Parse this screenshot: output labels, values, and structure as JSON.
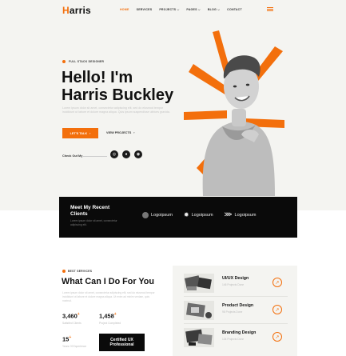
{
  "nav": {
    "logo_initial": "H",
    "logo_rest": "arris",
    "items": [
      {
        "label": "HOME",
        "active": true
      },
      {
        "label": "SERVICES",
        "active": false
      },
      {
        "label": "PROJECTS ⌵",
        "active": false
      },
      {
        "label": "PAGES ⌵",
        "active": false
      },
      {
        "label": "BLOG ⌵",
        "active": false
      },
      {
        "label": "CONTACT",
        "active": false
      }
    ],
    "menu_icon": "hamburger-icon"
  },
  "hero": {
    "badge": "FULL STACK DESIGNER",
    "title_line1": "Hello! I'm",
    "title_line2": "Harris Buckley",
    "description": "Lorem ipsum dolor sit amet, consectetur adipiscing elit, sed do eiusmod tempor incididunt ut labore et dolore magna aliqua. Quis ipsum suspendisse ultrices gravida.",
    "cta_primary": "LET'S TALK",
    "cta_secondary": "VIEW PROJECTS",
    "check_out": "Check Out My",
    "socials": [
      "dribbble-icon",
      "behance-icon",
      "instagram-icon"
    ]
  },
  "clients": {
    "title": "Meet My Recent Clients",
    "description": "Lorem ipsum dolor sit amet, consectetur adipiscing elit.",
    "logos": [
      "Logoipsum",
      "Logoipsum",
      "Logoipsum"
    ]
  },
  "services": {
    "badge": "BEST SERVICES",
    "title": "What Can I Do For You",
    "description": "Lorem ipsum dolor sit amet, consectetur adipiscing elit, sed do eiusmod tempor incididunt ut labore et dolore magna aliqua. Ut enim ad minim veniam, quis nostrud.",
    "stats": [
      {
        "value": "3,460",
        "suffix": "+",
        "label": "Satisfied Clients"
      },
      {
        "value": "1,458",
        "suffix": "+",
        "label": "Project Completed"
      },
      {
        "value": "15",
        "suffix": "+",
        "label": "Years Of Experience"
      }
    ],
    "certified_line1": "Certified UX",
    "certified_line2": "Professional",
    "items": [
      {
        "name": "UI/UX Design",
        "count": "146 Projects Done"
      },
      {
        "name": "Product Design",
        "count": "98 Projects Done"
      },
      {
        "name": "Branding Design",
        "count": "134 Projects Done"
      }
    ]
  },
  "colors": {
    "accent": "#f36f0c",
    "dark": "#0a0a0a",
    "bg": "#f4f4f1"
  }
}
